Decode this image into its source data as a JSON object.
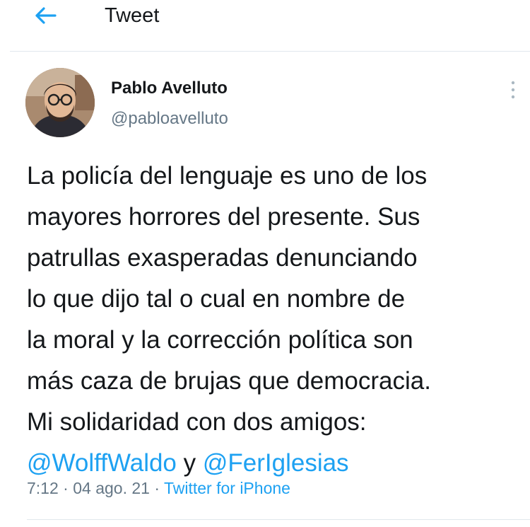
{
  "header": {
    "title": "Tweet",
    "back_icon": "arrow-left-icon"
  },
  "tweet": {
    "author": {
      "name": "Pablo Avelluto",
      "handle": "@pabloavelluto",
      "avatar_icon": "avatar-photo"
    },
    "text_lines": [
      "La policía del lenguaje es uno de los",
      "mayores horrores del presente. Sus",
      "patrullas exasperadas denunciando",
      "lo que dijo tal o cual en nombre de",
      "la moral y la corrección política son",
      "más caza de brujas que democracia.",
      "Mi solidaridad con dos amigos:"
    ],
    "mentions": {
      "first": "@WolffWaldo",
      "joiner": " y ",
      "second": "@FerIglesias"
    },
    "time": "7:12",
    "separator": " · ",
    "date": "04 ago. 21",
    "source": "Twitter for iPhone",
    "more_icon": "vertical-dots-icon"
  },
  "colors": {
    "accent": "#1da1f2",
    "text": "#14171a",
    "secondary": "#657786",
    "divider": "#e1e8ed"
  }
}
